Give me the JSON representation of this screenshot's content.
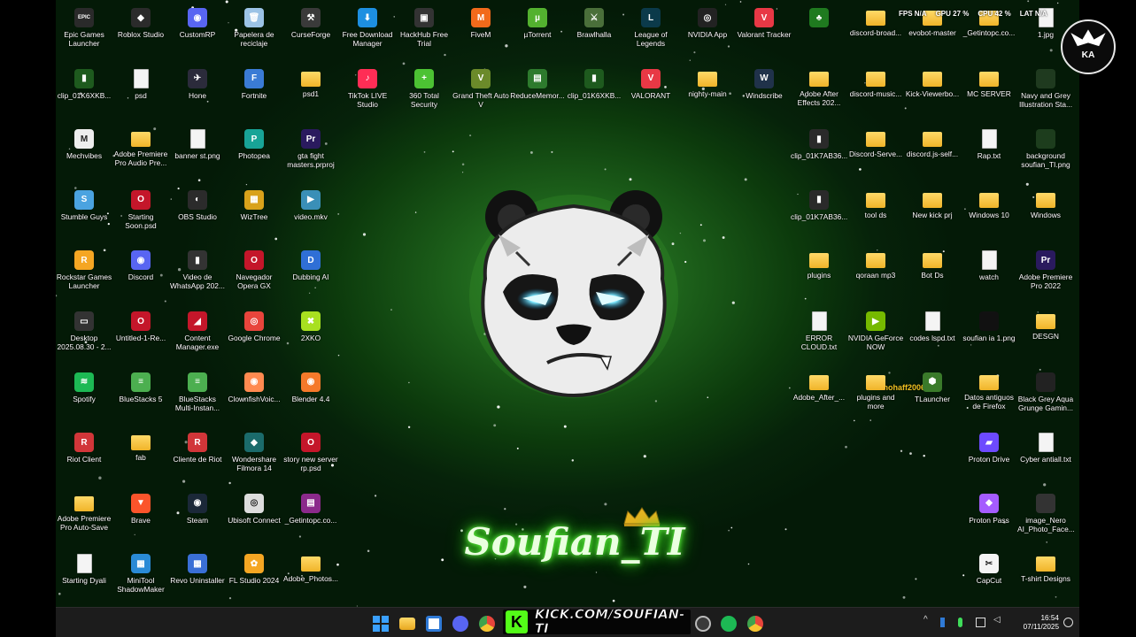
{
  "stats": {
    "fps": "FPS N/A",
    "gpu": "GPU 27 %",
    "cpu": "CPU 42 %",
    "lat": "LAT N/A"
  },
  "desktop_icons": [
    {
      "label": "Epic Games Launcher",
      "icon": "epic-games-icon",
      "kind": "app",
      "color": "#2a2a2a",
      "glyph": "EPIC"
    },
    {
      "label": "Roblox Studio",
      "icon": "roblox-icon",
      "kind": "app",
      "color": "#2b2b2b",
      "glyph": "◆"
    },
    {
      "label": "CustomRP",
      "icon": "discord-icon",
      "kind": "app",
      "color": "#5865f2",
      "glyph": "◉"
    },
    {
      "label": "Papelera de reciclaje",
      "icon": "recycle-bin-icon",
      "kind": "app",
      "color": "#9cc3e6",
      "glyph": "🗑"
    },
    {
      "label": "CurseForge",
      "icon": "curseforge-icon",
      "kind": "app",
      "color": "#3a3a3a",
      "glyph": "⚒"
    },
    {
      "label": "Free Download Manager",
      "icon": "fdm-icon",
      "kind": "app",
      "color": "#1d8fe1",
      "glyph": "⬇"
    },
    {
      "label": "HackHub Free Trial",
      "icon": "hackhub-icon",
      "kind": "app",
      "color": "#333",
      "glyph": "▣"
    },
    {
      "label": "FiveM",
      "icon": "fivem-icon",
      "kind": "app",
      "color": "#f26a1b",
      "glyph": "M"
    },
    {
      "label": "µTorrent",
      "icon": "utorrent-icon",
      "kind": "app",
      "color": "#53b12f",
      "glyph": "µ"
    },
    {
      "label": "Brawlhalla",
      "icon": "brawlhalla-icon",
      "kind": "app",
      "color": "#4a6f3a",
      "glyph": "⚔"
    },
    {
      "label": "League of Legends",
      "icon": "lol-icon",
      "kind": "app",
      "color": "#0b3a4a",
      "glyph": "L"
    },
    {
      "label": "NVIDIA App",
      "icon": "nvidia-icon",
      "kind": "app",
      "color": "#222",
      "glyph": "◎"
    },
    {
      "label": "Valorant Tracker",
      "icon": "valorant-tracker-icon",
      "kind": "app",
      "color": "#e83845",
      "glyph": "V"
    },
    {
      "label": "",
      "icon": "tree-icon",
      "kind": "app",
      "color": "#1f7a1f",
      "glyph": "♣"
    },
    {
      "label": "discord-broad...",
      "icon": "folder-icon",
      "kind": "folder"
    },
    {
      "label": "evobot-master",
      "icon": "folder-icon",
      "kind": "folder"
    },
    {
      "label": "_Getintopc.co...",
      "icon": "folder-icon",
      "kind": "folder"
    },
    {
      "label": "1.jpg",
      "icon": "image-file-icon",
      "kind": "file"
    },
    {
      "label": "clip_01K6XKB...",
      "icon": "video-clip-icon",
      "kind": "app",
      "color": "#1e5a1e",
      "glyph": "▮"
    },
    {
      "label": "psd",
      "icon": "file-icon",
      "kind": "file"
    },
    {
      "label": "Hone",
      "icon": "hone-icon",
      "kind": "app",
      "color": "#2b2b3b",
      "glyph": "✈"
    },
    {
      "label": "Fortnite",
      "icon": "fortnite-icon",
      "kind": "app",
      "color": "#3a7bd5",
      "glyph": "F"
    },
    {
      "label": "psd1",
      "icon": "folder-icon",
      "kind": "folder"
    },
    {
      "label": "TikTok LIVE Studio",
      "icon": "tiktok-icon",
      "kind": "app",
      "color": "#ff2d55",
      "glyph": "♪"
    },
    {
      "label": "360 Total Security",
      "icon": "360-security-icon",
      "kind": "app",
      "color": "#4cc233",
      "glyph": "+"
    },
    {
      "label": "Grand Theft Auto V",
      "icon": "gta-icon",
      "kind": "app",
      "color": "#6b8a2a",
      "glyph": "V"
    },
    {
      "label": "ReduceMemor...",
      "icon": "memory-icon",
      "kind": "app",
      "color": "#2d7a2d",
      "glyph": "▤"
    },
    {
      "label": "clip_01K6XKB...",
      "icon": "video-clip-icon",
      "kind": "app",
      "color": "#1e5a1e",
      "glyph": "▮"
    },
    {
      "label": "VALORANT",
      "icon": "valorant-icon",
      "kind": "app",
      "color": "#e83845",
      "glyph": "V"
    },
    {
      "label": "nighty-main",
      "icon": "folder-icon",
      "kind": "folder"
    },
    {
      "label": "Windscribe",
      "icon": "windscribe-icon",
      "kind": "app",
      "color": "#20324a",
      "glyph": "W"
    },
    {
      "label": "Adobe After Effects 202...",
      "icon": "folder-icon",
      "kind": "folder"
    },
    {
      "label": "discord-music...",
      "icon": "folder-icon",
      "kind": "folder"
    },
    {
      "label": "Kick-Viewerbo...",
      "icon": "folder-icon",
      "kind": "folder"
    },
    {
      "label": "MC SERVER",
      "icon": "folder-icon",
      "kind": "folder"
    },
    {
      "label": "Navy and Grey Illustration Sta...",
      "icon": "image-thumb-icon",
      "kind": "app",
      "color": "#1f3a1f",
      "glyph": ""
    },
    {
      "label": "Mechvibes",
      "icon": "mechvibes-icon",
      "kind": "app",
      "color": "#eee",
      "glyph": "M"
    },
    {
      "label": "Adobe Premiere Pro Audio Pre...",
      "icon": "folder-icon",
      "kind": "folder"
    },
    {
      "label": "banner st.png",
      "icon": "image-file-icon",
      "kind": "file"
    },
    {
      "label": "Photopea",
      "icon": "photopea-icon",
      "kind": "app",
      "color": "#18a497",
      "glyph": "P"
    },
    {
      "label": "gta fight masters.prproj",
      "icon": "premiere-project-icon",
      "kind": "app",
      "color": "#2a1a5e",
      "glyph": "Pr"
    },
    {
      "label": "clip_01K7AB36...",
      "icon": "video-clip-icon",
      "kind": "app",
      "color": "#2a2a2a",
      "glyph": "▮"
    },
    {
      "label": "Discord-Serve...",
      "icon": "folder-icon",
      "kind": "folder"
    },
    {
      "label": "discord.js-self...",
      "icon": "folder-icon",
      "kind": "folder"
    },
    {
      "label": "Rap.txt",
      "icon": "text-file-icon",
      "kind": "file"
    },
    {
      "label": "background soufian_TI.png",
      "icon": "image-thumb-icon",
      "kind": "app",
      "color": "#1d3d1d",
      "glyph": ""
    },
    {
      "label": "Stumble Guys",
      "icon": "stumble-guys-icon",
      "kind": "app",
      "color": "#4aa3e0",
      "glyph": "S"
    },
    {
      "label": "Starting Soon.psd",
      "icon": "opera-psd-icon",
      "kind": "app",
      "color": "#c4162a",
      "glyph": "O"
    },
    {
      "label": "OBS Studio",
      "icon": "obs-icon",
      "kind": "app",
      "color": "#2b2b2b",
      "glyph": "◐"
    },
    {
      "label": "WizTree",
      "icon": "wiztree-icon",
      "kind": "app",
      "color": "#d9a21b",
      "glyph": "▦"
    },
    {
      "label": "video.mkv",
      "icon": "video-file-icon",
      "kind": "app",
      "color": "#3a8fb7",
      "glyph": "▶"
    },
    {
      "label": "clip_01K7AB36...",
      "icon": "video-clip-icon",
      "kind": "app",
      "color": "#2a2a2a",
      "glyph": "▮"
    },
    {
      "label": "tool ds",
      "icon": "folder-icon",
      "kind": "folder"
    },
    {
      "label": "New kick prj",
      "icon": "folder-icon",
      "kind": "folder"
    },
    {
      "label": "Windows 10",
      "icon": "folder-icon",
      "kind": "folder"
    },
    {
      "label": "Windows",
      "icon": "folder-icon",
      "kind": "folder"
    },
    {
      "label": "Rockstar Games Launcher",
      "icon": "rockstar-icon",
      "kind": "app",
      "color": "#f5a623",
      "glyph": "R"
    },
    {
      "label": "Discord",
      "icon": "discord-icon",
      "kind": "app",
      "color": "#5865f2",
      "glyph": "◉"
    },
    {
      "label": "Video de WhatsApp 202...",
      "icon": "video-clip-icon",
      "kind": "app",
      "color": "#333",
      "glyph": "▮"
    },
    {
      "label": "Navegador Opera GX",
      "icon": "opera-gx-icon",
      "kind": "app",
      "color": "#c4162a",
      "glyph": "O"
    },
    {
      "label": "Dubbing AI",
      "icon": "dubbing-ai-icon",
      "kind": "app",
      "color": "#2f6fd6",
      "glyph": "D"
    },
    {
      "label": "plugins",
      "icon": "folder-icon",
      "kind": "folder"
    },
    {
      "label": "qoraan mp3",
      "icon": "folder-icon",
      "kind": "folder"
    },
    {
      "label": "Bot Ds",
      "icon": "folder-icon",
      "kind": "folder"
    },
    {
      "label": "watch",
      "icon": "watch-file-icon",
      "kind": "file"
    },
    {
      "label": "Adobe Premiere Pro 2022",
      "icon": "premiere-icon",
      "kind": "app",
      "color": "#2a1a5e",
      "glyph": "Pr"
    },
    {
      "label": "Desktop 2025.08.30 - 2...",
      "icon": "desktop-video-icon",
      "kind": "app",
      "color": "#333",
      "glyph": "▭"
    },
    {
      "label": "Untitled-1-Re...",
      "icon": "opera-psd-icon",
      "kind": "app",
      "color": "#c4162a",
      "glyph": "O"
    },
    {
      "label": "Content Manager.exe",
      "icon": "content-manager-icon",
      "kind": "app",
      "color": "#c4162a",
      "glyph": "◢"
    },
    {
      "label": "Google Chrome",
      "icon": "chrome-icon",
      "kind": "app",
      "color": "#e8453c",
      "glyph": "◎"
    },
    {
      "label": "2XKO",
      "icon": "2xko-icon",
      "kind": "app",
      "color": "#a8e020",
      "glyph": "✖"
    },
    {
      "label": "ERROR CLOUD.txt",
      "icon": "text-file-icon",
      "kind": "file"
    },
    {
      "label": "NVIDIA GeForce NOW",
      "icon": "geforce-now-icon",
      "kind": "app",
      "color": "#76b900",
      "glyph": "▶"
    },
    {
      "label": "codes lspd.txt",
      "icon": "text-file-icon",
      "kind": "file"
    },
    {
      "label": "soufian ia 1.png",
      "icon": "image-thumb-icon",
      "kind": "app",
      "color": "#111",
      "glyph": ""
    },
    {
      "label": "DESGN",
      "icon": "folder-icon",
      "kind": "folder"
    },
    {
      "label": "Spotify",
      "icon": "spotify-icon",
      "kind": "app",
      "color": "#1db954",
      "glyph": "≋"
    },
    {
      "label": "BlueStacks 5",
      "icon": "bluestacks-icon",
      "kind": "app",
      "color": "#4caf50",
      "glyph": "≡"
    },
    {
      "label": "BlueStacks Multi-Instan...",
      "icon": "bluestacks-multi-icon",
      "kind": "app",
      "color": "#4caf50",
      "glyph": "≡"
    },
    {
      "label": "ClownfishVoic...",
      "icon": "clownfish-icon",
      "kind": "app",
      "color": "#ff8a50",
      "glyph": "◉"
    },
    {
      "label": "Blender 4.4",
      "icon": "blender-icon",
      "kind": "app",
      "color": "#f5792a",
      "glyph": "◉"
    },
    {
      "label": "Adobe_After_...",
      "icon": "folder-icon",
      "kind": "folder"
    },
    {
      "label": "plugins and more",
      "icon": "folder-icon",
      "kind": "folder"
    },
    {
      "label": "TLauncher",
      "icon": "tlauncher-icon",
      "kind": "app",
      "color": "#3a7a2a",
      "glyph": "⬢"
    },
    {
      "label": "Datos antiguos de Firefox",
      "icon": "folder-icon",
      "kind": "folder"
    },
    {
      "label": "Black Grey Aqua Grunge Gamin...",
      "icon": "image-thumb-icon",
      "kind": "app",
      "color": "#222",
      "glyph": ""
    },
    {
      "label": "Riot Client",
      "icon": "riot-client-icon",
      "kind": "app",
      "color": "#d13639",
      "glyph": "R"
    },
    {
      "label": "fab",
      "icon": "folder-icon",
      "kind": "folder"
    },
    {
      "label": "Cliente de Riot",
      "icon": "riot-client-icon",
      "kind": "app",
      "color": "#d13639",
      "glyph": "R"
    },
    {
      "label": "Wondershare Filmora 14",
      "icon": "filmora-icon",
      "kind": "app",
      "color": "#1b6b6b",
      "glyph": "◆"
    },
    {
      "label": "story new server rp.psd",
      "icon": "opera-psd-icon",
      "kind": "app",
      "color": "#c4162a",
      "glyph": "O"
    },
    {
      "label": "Proton Drive",
      "icon": "proton-drive-icon",
      "kind": "app",
      "color": "#6d4aff",
      "glyph": "▰"
    },
    {
      "label": "Cyber antiall.txt",
      "icon": "text-file-icon",
      "kind": "file"
    },
    {
      "label": "Adobe Premiere Pro Auto-Save",
      "icon": "folder-icon",
      "kind": "folder"
    },
    {
      "label": "Brave",
      "icon": "brave-icon",
      "kind": "app",
      "color": "#fb542b",
      "glyph": "▼"
    },
    {
      "label": "Steam",
      "icon": "steam-icon",
      "kind": "app",
      "color": "#1b2838",
      "glyph": "◉"
    },
    {
      "label": "Ubisoft Connect",
      "icon": "ubisoft-icon",
      "kind": "app",
      "color": "#ddd",
      "glyph": "◎"
    },
    {
      "label": "_Getintopc.co...",
      "icon": "winrar-icon",
      "kind": "app",
      "color": "#8b2a8b",
      "glyph": "▤"
    },
    {
      "label": "Proton Pass",
      "icon": "proton-pass-icon",
      "kind": "app",
      "color": "#a55cff",
      "glyph": "◆"
    },
    {
      "label": "image_Nero AI_Photo_Face...",
      "icon": "image-thumb-icon",
      "kind": "app",
      "color": "#333",
      "glyph": ""
    },
    {
      "label": "Starting Dyali",
      "icon": "file-icon",
      "kind": "file"
    },
    {
      "label": "MiniTool ShadowMaker",
      "icon": "minitool-icon",
      "kind": "app",
      "color": "#2a8ad6",
      "glyph": "▦"
    },
    {
      "label": "Revo Uninstaller",
      "icon": "revo-icon",
      "kind": "app",
      "color": "#3a6fd6",
      "glyph": "▦"
    },
    {
      "label": "FL Studio 2024",
      "icon": "fl-studio-icon",
      "kind": "app",
      "color": "#f5a623",
      "glyph": "✿"
    },
    {
      "label": "Adobe_Photos...",
      "icon": "folder-icon",
      "kind": "folder"
    },
    {
      "label": "CapCut",
      "icon": "capcut-icon",
      "kind": "app",
      "color": "#f4f4f4",
      "glyph": "✂"
    },
    {
      "label": "T-shirt Designs",
      "icon": "folder-icon",
      "kind": "folder"
    }
  ],
  "wallpaper": {
    "brand_text": "Soufian_TI",
    "overlay_name": "mohaff2006"
  },
  "taskbar": {
    "kick_logo": "K",
    "kick_url": "KICK.COM/SOUFIAN-TI",
    "apps": [
      {
        "name": "start-button",
        "icon": "windows-start-icon"
      },
      {
        "name": "file-explorer-button",
        "icon": "file-explorer-icon"
      },
      {
        "name": "store-button",
        "icon": "store-icon"
      },
      {
        "name": "discord-taskbar-button",
        "icon": "discord-icon"
      },
      {
        "name": "chrome-taskbar-button",
        "icon": "chrome-icon"
      },
      {
        "name": "obs-taskbar-button",
        "icon": "obs-icon"
      },
      {
        "name": "spotify-taskbar-button",
        "icon": "spotify-icon"
      },
      {
        "name": "chrome-profile-taskbar-button",
        "icon": "chrome-icon"
      }
    ],
    "clock": {
      "time": "16:54",
      "date": "07/11/2025"
    }
  },
  "colors": {
    "accent_green": "#53fc18",
    "wallpaper_green": "#2f8a2a",
    "taskbar": "#1c1c1c"
  }
}
